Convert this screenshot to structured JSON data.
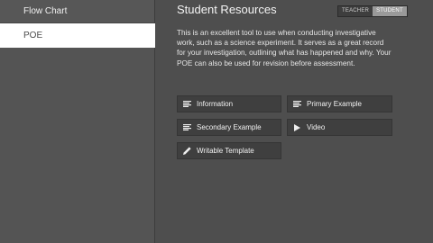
{
  "sidebar": {
    "items": [
      {
        "label": "Flow Chart"
      },
      {
        "label": "POE"
      }
    ]
  },
  "main": {
    "title": "Student Resources",
    "toggle": {
      "teacher": "TEACHER",
      "student": "STUDENT",
      "selected": "STUDENT"
    },
    "description": "This is an excellent tool to use when conducting investigative work, such as a science experiment. It serves as a great record for your investigation, outlining what has happened and why. Your POE can also be used for revision before assessment.",
    "resources": [
      {
        "label": "Information",
        "icon": "text-lines-icon"
      },
      {
        "label": "Primary Example",
        "icon": "text-lines-icon"
      },
      {
        "label": "Secondary Example",
        "icon": "text-lines-icon"
      },
      {
        "label": "Video",
        "icon": "play-icon"
      },
      {
        "label": "Writable Template",
        "icon": "pencil-icon"
      }
    ]
  },
  "colors": {
    "background": "#4e4e4e",
    "sidebar": "#545454",
    "active": "#ffffff",
    "button": "#3f3f3f"
  }
}
